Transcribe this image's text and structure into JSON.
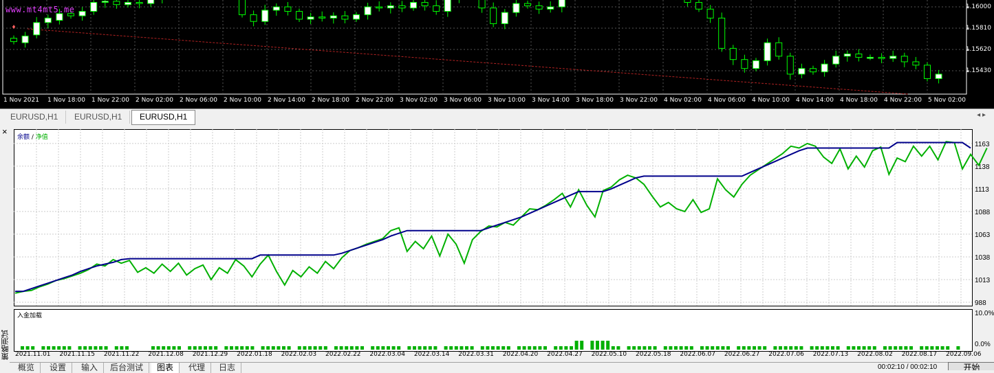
{
  "price_chart": {
    "watermark": "www.mt4mt5.me",
    "price_labels": [
      "1.16000",
      "1.15810",
      "1.15620",
      "1.15430"
    ],
    "time_labels": [
      "1 Nov 2021",
      "1 Nov 18:00",
      "1 Nov 22:00",
      "2 Nov 02:00",
      "2 Nov 06:00",
      "2 Nov 10:00",
      "2 Nov 14:00",
      "2 Nov 18:00",
      "2 Nov 22:00",
      "3 Nov 02:00",
      "3 Nov 06:00",
      "3 Nov 10:00",
      "3 Nov 14:00",
      "3 Nov 18:00",
      "3 Nov 22:00",
      "4 Nov 02:00",
      "4 Nov 06:00",
      "4 Nov 10:00",
      "4 Nov 14:00",
      "4 Nov 18:00",
      "4 Nov 22:00",
      "5 Nov 02:00"
    ],
    "bull_color": "#ffffff",
    "bear_color": "#000000",
    "wick_color": "#00ff00",
    "trendline_color": "#b22222",
    "ohlc_close": [
      1.1569,
      1.1574,
      1.1586,
      1.159,
      1.1594,
      1.1592,
      1.1596,
      1.1604,
      1.1605,
      1.1602,
      1.1604,
      1.1603,
      1.1608,
      1.1612,
      1.1618,
      1.162,
      1.1612,
      1.1624,
      1.1627,
      1.1615,
      1.1593,
      1.1587,
      1.1597,
      1.16,
      1.1596,
      1.1589,
      1.1591,
      1.159,
      1.1592,
      1.1589,
      1.1593,
      1.16,
      1.1599,
      1.1601,
      1.1599,
      1.1604,
      1.1601,
      1.1596,
      1.1607,
      1.1614,
      1.1609,
      1.1599,
      1.1585,
      1.1595,
      1.1603,
      1.1601,
      1.1598,
      1.16,
      1.1626,
      1.164,
      1.1634,
      1.1641,
      1.1632,
      1.1628,
      1.1642,
      1.164,
      1.1621,
      1.1618,
      1.1611,
      1.1604,
      1.1598,
      1.159,
      1.1563,
      1.1553,
      1.1545,
      1.1552,
      1.1568,
      1.1556,
      1.154,
      1.1545,
      1.1542,
      1.1549,
      1.1556,
      1.1558,
      1.1555,
      1.1555,
      1.1554,
      1.1556,
      1.1551,
      1.1548,
      1.1536,
      1.154
    ],
    "ohlc_open": [
      1.1572,
      1.1568,
      1.1575,
      1.1586,
      1.1588,
      1.1594,
      1.1592,
      1.1596,
      1.1604,
      1.1605,
      1.1602,
      1.1604,
      1.1603,
      1.1608,
      1.1612,
      1.1618,
      1.162,
      1.1612,
      1.1624,
      1.1627,
      1.1615,
      1.1593,
      1.1587,
      1.1597,
      1.16,
      1.1596,
      1.1589,
      1.1591,
      1.159,
      1.1592,
      1.1589,
      1.1593,
      1.16,
      1.1599,
      1.1601,
      1.1599,
      1.1604,
      1.1601,
      1.1596,
      1.1607,
      1.1614,
      1.1609,
      1.1599,
      1.1585,
      1.1595,
      1.1603,
      1.1601,
      1.1598,
      1.16,
      1.1626,
      1.164,
      1.1634,
      1.1641,
      1.1632,
      1.1628,
      1.1642,
      1.164,
      1.1621,
      1.1618,
      1.1611,
      1.1604,
      1.1598,
      1.159,
      1.1563,
      1.1553,
      1.1545,
      1.1552,
      1.1568,
      1.1556,
      1.154,
      1.1545,
      1.1542,
      1.1549,
      1.1556,
      1.1558,
      1.1555,
      1.1555,
      1.1554,
      1.1556,
      1.1551,
      1.1548,
      1.1536
    ],
    "price_range": [
      1.153,
      1.163
    ]
  },
  "chart_tabs": [
    {
      "label": "EURUSD,H1"
    },
    {
      "label": "EURUSD,H1"
    },
    {
      "label": "EURUSD,H1"
    }
  ],
  "tester": {
    "close_icon": "×",
    "legend_balance": "余额",
    "legend_sep": " / ",
    "legend_equity": "净值",
    "balance_color": "#00008b",
    "equity_color": "#00b000",
    "volume_color": "#00b000",
    "volume_label": "入金加载",
    "side_label": "策略测试",
    "start_button": "开始",
    "status_time": "00:02:10 / 00:02:10",
    "bottom_tabs": [
      "概览",
      "设置",
      "输入",
      "后台测试",
      "图表",
      "代理",
      "日志"
    ],
    "active_tab": 4
  },
  "chart_data": {
    "type": "line",
    "title": "",
    "xlabel": "",
    "ylabel": "",
    "ylim": [
      988,
      1175
    ],
    "y_ticks": [
      "1163",
      "1138",
      "1113",
      "1088",
      "1063",
      "1038",
      "1013",
      "988"
    ],
    "x_labels": [
      "2021.11.01",
      "2021.11.15",
      "2021.11.22",
      "2021.12.08",
      "2021.12.29",
      "2022.01.18",
      "2022.02.03",
      "2022.02.22",
      "2022.03.04",
      "2022.03.14",
      "2022.03.31",
      "2022.04.20",
      "2022.04.27",
      "2022.05.10",
      "2022.05.18",
      "2022.06.07",
      "2022.06.27",
      "2022.07.06",
      "2022.07.13",
      "2022.08.02",
      "2022.08.17",
      "2022.09.06"
    ],
    "series": [
      {
        "name": "余额",
        "values": [
          1000,
          1000,
          1003,
          1006,
          1009,
          1012,
          1015,
          1018,
          1022,
          1025,
          1028,
          1030,
          1032,
          1035,
          1036,
          1036,
          1036,
          1036,
          1036,
          1036,
          1036,
          1036,
          1036,
          1036,
          1036,
          1036,
          1036,
          1036,
          1036,
          1036,
          1040,
          1040,
          1040,
          1040,
          1040,
          1040,
          1040,
          1040,
          1040,
          1040,
          1042,
          1045,
          1048,
          1051,
          1054,
          1057,
          1061,
          1064,
          1067,
          1067,
          1067,
          1067,
          1067,
          1067,
          1067,
          1067,
          1067,
          1067,
          1070,
          1073,
          1076,
          1079,
          1082,
          1086,
          1090,
          1094,
          1098,
          1102,
          1106,
          1110,
          1110,
          1110,
          1110,
          1113,
          1117,
          1121,
          1125,
          1127,
          1127,
          1127,
          1127,
          1127,
          1127,
          1127,
          1127,
          1127,
          1127,
          1127,
          1127,
          1127,
          1131,
          1135,
          1139,
          1143,
          1147,
          1151,
          1155,
          1158,
          1158,
          1158,
          1158,
          1158,
          1158,
          1158,
          1158,
          1158,
          1158,
          1158,
          1164,
          1164,
          1164,
          1164,
          1164,
          1164,
          1164,
          1164,
          1164,
          1158
        ]
      },
      {
        "name": "净值",
        "values": [
          998,
          1000,
          1001,
          1005,
          1008,
          1012,
          1014,
          1017,
          1020,
          1024,
          1030,
          1028,
          1035,
          1031,
          1034,
          1021,
          1026,
          1020,
          1030,
          1022,
          1031,
          1018,
          1025,
          1029,
          1013,
          1026,
          1020,
          1035,
          1028,
          1016,
          1030,
          1040,
          1022,
          1007,
          1023,
          1016,
          1027,
          1020,
          1033,
          1025,
          1037,
          1045,
          1048,
          1052,
          1055,
          1058,
          1067,
          1070,
          1044,
          1055,
          1047,
          1061,
          1039,
          1063,
          1052,
          1031,
          1057,
          1066,
          1072,
          1071,
          1076,
          1073,
          1082,
          1091,
          1090,
          1095,
          1101,
          1108,
          1093,
          1112,
          1095,
          1082,
          1111,
          1115,
          1123,
          1128,
          1125,
          1118,
          1105,
          1093,
          1098,
          1091,
          1088,
          1101,
          1087,
          1091,
          1124,
          1112,
          1104,
          1118,
          1128,
          1134,
          1140,
          1146,
          1152,
          1160,
          1158,
          1163,
          1160,
          1148,
          1141,
          1157,
          1135,
          1149,
          1137,
          1155,
          1159,
          1129,
          1147,
          1143,
          1160,
          1149,
          1160,
          1145,
          1165,
          1164,
          1135,
          1151,
          1139,
          1158
        ]
      }
    ],
    "volume_axis": [
      "10.0%",
      "0.0%"
    ]
  }
}
